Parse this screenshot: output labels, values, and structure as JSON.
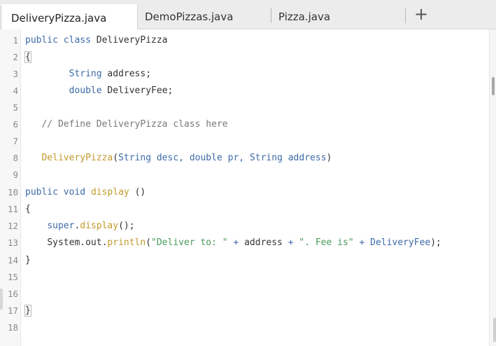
{
  "tabs": [
    {
      "label": "DeliveryPizza.java",
      "active": true
    },
    {
      "label": "DemoPizzas.java",
      "active": false
    },
    {
      "label": "Pizza.java",
      "active": false
    }
  ],
  "new_tab_label": "+",
  "line_numbers": [
    "1",
    "2",
    "3",
    "4",
    "5",
    "6",
    "7",
    "8",
    "9",
    "10",
    "11",
    "12",
    "13",
    "14",
    "15",
    "16",
    "17",
    "18"
  ],
  "code": {
    "l1": {
      "k1": "public",
      "k2": "class",
      "name": "DeliveryPizza"
    },
    "l2": {
      "brace": "{"
    },
    "l3": {
      "type": "String",
      "rest": "address;"
    },
    "l4": {
      "type": "double",
      "rest": "DeliveryFee;"
    },
    "l6": {
      "comment": "// Define DeliveryPizza class here"
    },
    "l8": {
      "fn": "DeliveryPizza",
      "p1": "(",
      "t1": "String",
      "a1": "desc,",
      "t2": "double",
      "a2": "pr,",
      "t3": "String",
      "a3": "address",
      "p2": ")"
    },
    "l10": {
      "k1": "public",
      "k2": "void",
      "fn": "display",
      "args": "()"
    },
    "l11": {
      "brace": "{"
    },
    "l12": {
      "kw": "super",
      "dot": ".",
      "fn": "display",
      "rest": "();"
    },
    "l13": {
      "obj": "System.out.",
      "fn": "println",
      "p1": "(",
      "s1": "\"Deliver to: \"",
      "plus1": "+",
      "v1": "address",
      "plus2": "+",
      "s2": "\". Fee is\"",
      "plus3": "+",
      "v2": "DeliveryFee",
      "end": ");"
    },
    "l14": {
      "brace": "}"
    },
    "l17": {
      "brace": "}"
    }
  }
}
